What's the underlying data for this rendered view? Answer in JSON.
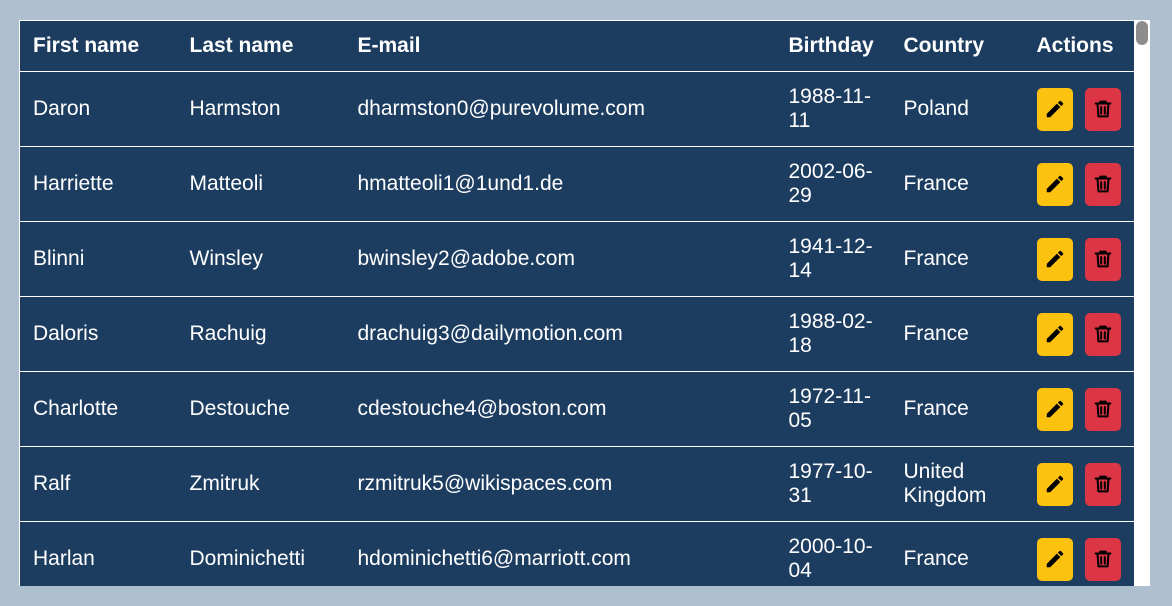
{
  "table": {
    "headers": {
      "first_name": "First name",
      "last_name": "Last name",
      "email": "E-mail",
      "birthday": "Birthday",
      "country": "Country",
      "actions": "Actions"
    },
    "rows": [
      {
        "first_name": "Daron",
        "last_name": "Harmston",
        "email": "dharmston0@purevolume.com",
        "birthday": "1988-11-11",
        "country": "Poland"
      },
      {
        "first_name": "Harriette",
        "last_name": "Matteoli",
        "email": "hmatteoli1@1und1.de",
        "birthday": "2002-06-29",
        "country": "France"
      },
      {
        "first_name": "Blinni",
        "last_name": "Winsley",
        "email": "bwinsley2@adobe.com",
        "birthday": "1941-12-14",
        "country": "France"
      },
      {
        "first_name": "Daloris",
        "last_name": "Rachuig",
        "email": "drachuig3@dailymotion.com",
        "birthday": "1988-02-18",
        "country": "France"
      },
      {
        "first_name": "Charlotte",
        "last_name": "Destouche",
        "email": "cdestouche4@boston.com",
        "birthday": "1972-11-05",
        "country": "France"
      },
      {
        "first_name": "Ralf",
        "last_name": "Zmitruk",
        "email": "rzmitruk5@wikispaces.com",
        "birthday": "1977-10-31",
        "country": "United Kingdom"
      },
      {
        "first_name": "Harlan",
        "last_name": "Dominichetti",
        "email": "hdominichetti6@marriott.com",
        "birthday": "2000-10-04",
        "country": "France"
      }
    ],
    "row_actions": [
      {
        "icon": "pencil-icon",
        "color": "#fdc10f"
      },
      {
        "icon": "trash-icon",
        "color": "#dc3545"
      }
    ]
  },
  "colors": {
    "page_background": "#aebfcf",
    "table_background": "#1d3d60",
    "text": "#ffffff"
  }
}
